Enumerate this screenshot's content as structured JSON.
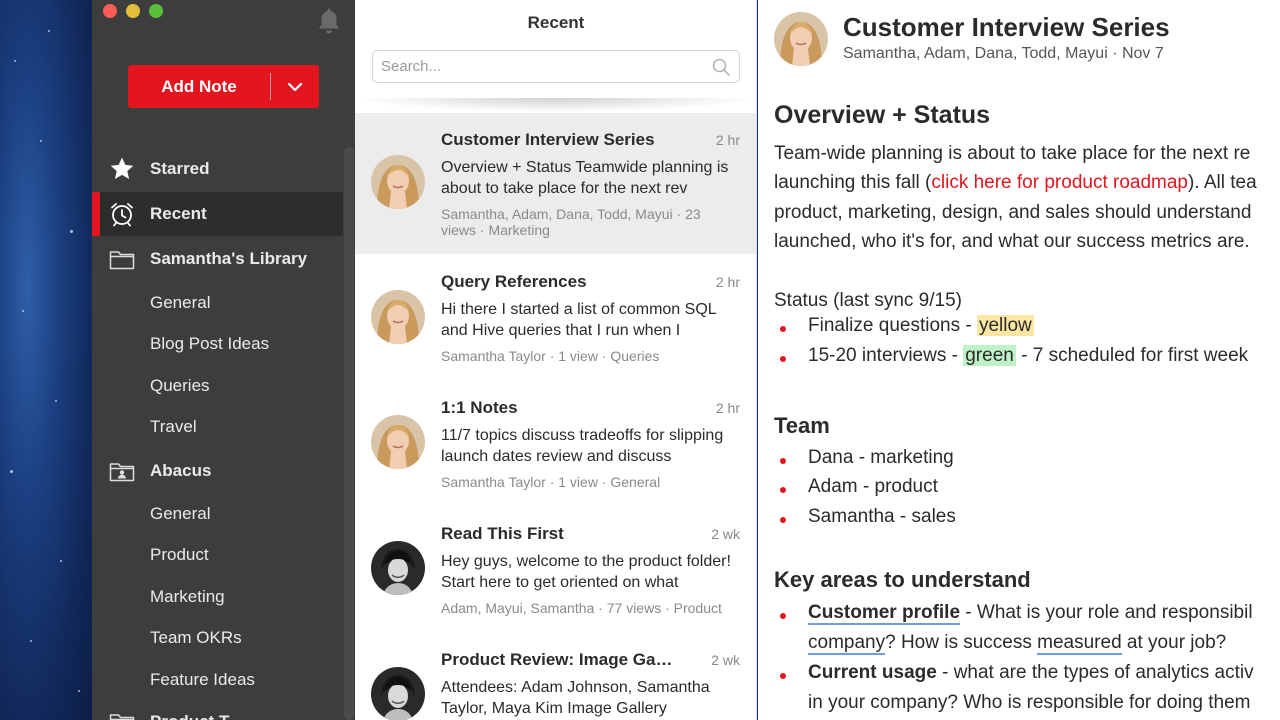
{
  "app": {
    "accent": "#e3151f"
  },
  "sidebar": {
    "add_note_label": "Add Note",
    "items": [
      {
        "label": "Starred",
        "icon": "star-icon",
        "bold": true
      },
      {
        "label": "Recent",
        "icon": "alarm-clock-icon",
        "bold": true,
        "active": true
      },
      {
        "label": "Samantha's Library",
        "icon": "folder-icon",
        "bold": true
      },
      {
        "label": "General"
      },
      {
        "label": "Blog Post Ideas"
      },
      {
        "label": "Queries"
      },
      {
        "label": "Travel"
      },
      {
        "label": "Abacus",
        "icon": "shared-folder-icon",
        "bold": true
      },
      {
        "label": "General"
      },
      {
        "label": "Product"
      },
      {
        "label": "Marketing"
      },
      {
        "label": "Team OKRs"
      },
      {
        "label": "Feature Ideas"
      },
      {
        "label": "Product T",
        "icon": "folder-icon",
        "bold": true
      }
    ]
  },
  "list": {
    "title": "Recent",
    "search_placeholder": "Search...",
    "notes": [
      {
        "title": "Customer Interview Series",
        "time": "2 hr",
        "excerpt_line1": "Overview + Status Teamwide planning is",
        "excerpt_line2": "about to take place for the next rev",
        "meta_line1": "Samantha, Adam, Dana, Todd, Mayui · 23",
        "meta_line2": "views · Marketing",
        "avatar": "samantha-avatar",
        "selected": true
      },
      {
        "title": "Query References",
        "time": "2 hr",
        "excerpt_line1": "Hi there I started a list of common SQL",
        "excerpt_line2": "and Hive queries that I run when I",
        "meta_line1": "Samantha Taylor · 1 view · Queries",
        "avatar": "samantha-avatar"
      },
      {
        "title": "1:1 Notes",
        "time": "2 hr",
        "excerpt_line1": "11/7 topics discuss tradeoffs for slipping",
        "excerpt_line2": "launch dates review and discuss",
        "meta_line1": "Samantha Taylor · 1 view · General",
        "avatar": "samantha-avatar"
      },
      {
        "title": "Read This First",
        "time": "2 wk",
        "excerpt_line1": "Hey guys, welcome to the product folder!",
        "excerpt_line2": "Start here to get oriented on what",
        "meta_line1": "Adam, Mayui, Samantha · 77 views · Product",
        "avatar": "adam-avatar"
      },
      {
        "title": "Product Review: Image Ga…",
        "time": "2 wk",
        "excerpt_line1": "Attendees: Adam Johnson, Samantha",
        "excerpt_line2": "Taylor, Maya Kim Image Gallery",
        "meta_line1": "",
        "avatar": "adam-avatar"
      }
    ]
  },
  "detail": {
    "title": "Customer Interview Series",
    "subtitle": "Samantha, Adam, Dana, Todd, Mayui · Nov 7",
    "overview_heading": "Overview + Status",
    "overview_line1": "Team-wide planning is about to take place for the next re",
    "overview_line2_pre": "launching this fall (",
    "overview_link": "click here for product roadmap",
    "overview_line2_post": "). All tea",
    "overview_line3": "product, marketing, design, and sales should understand",
    "overview_line4": "launched, who it's for, and what our success metrics are.",
    "status_line": "Status (last sync 9/15)",
    "status_items": [
      {
        "pre": "Finalize questions - ",
        "highlight": "yellow",
        "post": ""
      },
      {
        "pre": "15-20 interviews - ",
        "highlight": "green",
        "post": " - 7 scheduled for first week"
      }
    ],
    "team_heading": "Team",
    "team": [
      "Dana - marketing",
      "Adam - product",
      "Samantha - sales"
    ],
    "key_heading": "Key areas to understand",
    "key_items": [
      {
        "term": "Customer profile",
        "rest1": " - What is your role and responsibil",
        "line2_pre": "",
        "line2_u1": "company",
        "line2_mid": "? How is success ",
        "line2_u2": "measured",
        "line2_post": " at your job?"
      },
      {
        "term": "Current usage",
        "rest1": " - what are the types of analytics activ",
        "line2": "in your company? Who is responsible for doing them"
      }
    ]
  }
}
